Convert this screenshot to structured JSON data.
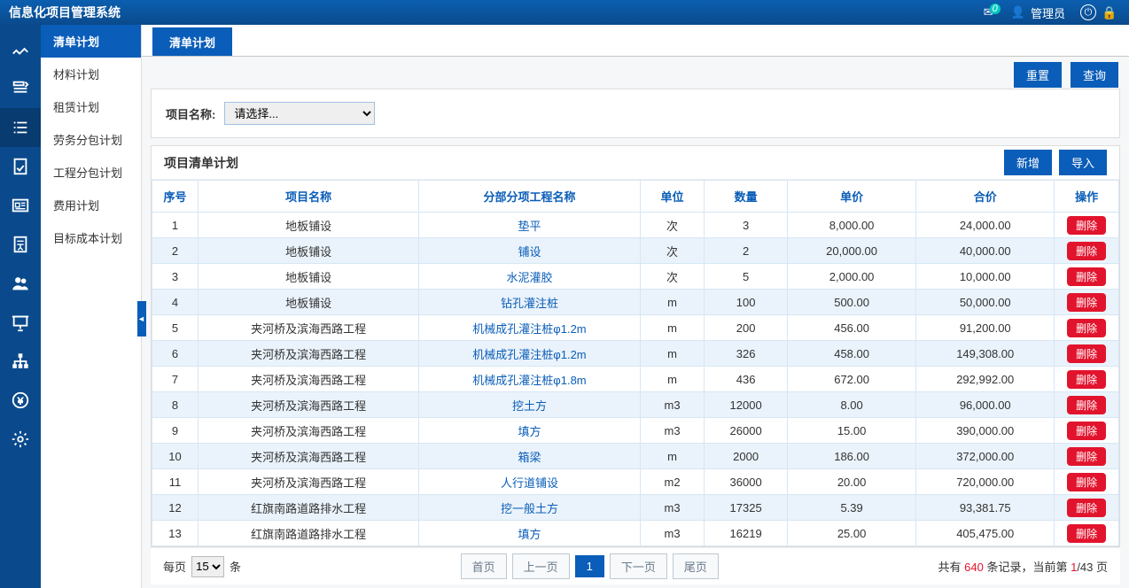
{
  "app_title": "信息化项目管理系统",
  "topbar": {
    "mail_badge": "0",
    "user_label": "管理员"
  },
  "subnav": {
    "items": [
      {
        "label": "清单计划",
        "active": true
      },
      {
        "label": "材料计划"
      },
      {
        "label": "租赁计划"
      },
      {
        "label": "劳务分包计划"
      },
      {
        "label": "工程分包计划"
      },
      {
        "label": "费用计划"
      },
      {
        "label": "目标成本计划"
      }
    ]
  },
  "tab_label": "清单计划",
  "filter": {
    "label": "项目名称:",
    "placeholder": "请选择...",
    "reset": "重置",
    "query": "查询"
  },
  "section": {
    "title": "项目清单计划",
    "add": "新增",
    "import": "导入"
  },
  "columns": [
    "序号",
    "项目名称",
    "分部分项工程名称",
    "单位",
    "数量",
    "单价",
    "合价",
    "操作"
  ],
  "delete_label": "删除",
  "rows": [
    {
      "no": "1",
      "proj": "地板铺设",
      "task": "垫平",
      "unit": "次",
      "qty": "3",
      "price": "8,000.00",
      "total": "24,000.00"
    },
    {
      "no": "2",
      "proj": "地板铺设",
      "task": "铺设",
      "unit": "次",
      "qty": "2",
      "price": "20,000.00",
      "total": "40,000.00"
    },
    {
      "no": "3",
      "proj": "地板铺设",
      "task": "水泥灌胶",
      "unit": "次",
      "qty": "5",
      "price": "2,000.00",
      "total": "10,000.00"
    },
    {
      "no": "4",
      "proj": "地板铺设",
      "task": "钻孔灌注桩",
      "unit": "m",
      "qty": "100",
      "price": "500.00",
      "total": "50,000.00"
    },
    {
      "no": "5",
      "proj": "夹河桥及滨海西路工程",
      "task": "机械成孔灌注桩φ1.2m",
      "unit": "m",
      "qty": "200",
      "price": "456.00",
      "total": "91,200.00"
    },
    {
      "no": "6",
      "proj": "夹河桥及滨海西路工程",
      "task": "机械成孔灌注桩φ1.2m",
      "unit": "m",
      "qty": "326",
      "price": "458.00",
      "total": "149,308.00"
    },
    {
      "no": "7",
      "proj": "夹河桥及滨海西路工程",
      "task": "机械成孔灌注桩φ1.8m",
      "unit": "m",
      "qty": "436",
      "price": "672.00",
      "total": "292,992.00"
    },
    {
      "no": "8",
      "proj": "夹河桥及滨海西路工程",
      "task": "挖土方",
      "unit": "m3",
      "qty": "12000",
      "price": "8.00",
      "total": "96,000.00"
    },
    {
      "no": "9",
      "proj": "夹河桥及滨海西路工程",
      "task": "填方",
      "unit": "m3",
      "qty": "26000",
      "price": "15.00",
      "total": "390,000.00"
    },
    {
      "no": "10",
      "proj": "夹河桥及滨海西路工程",
      "task": "箱梁",
      "unit": "m",
      "qty": "2000",
      "price": "186.00",
      "total": "372,000.00"
    },
    {
      "no": "11",
      "proj": "夹河桥及滨海西路工程",
      "task": "人行道铺设",
      "unit": "m2",
      "qty": "36000",
      "price": "20.00",
      "total": "720,000.00"
    },
    {
      "no": "12",
      "proj": "红旗南路道路排水工程",
      "task": "挖一般土方",
      "unit": "m3",
      "qty": "17325",
      "price": "5.39",
      "total": "93,381.75"
    },
    {
      "no": "13",
      "proj": "红旗南路道路排水工程",
      "task": "填方",
      "unit": "m3",
      "qty": "16219",
      "price": "25.00",
      "total": "405,475.00"
    }
  ],
  "pager": {
    "per_page_label_left": "每页",
    "per_page_value": "15",
    "per_page_label_right": "条",
    "first": "首页",
    "prev": "上一页",
    "current": "1",
    "next": "下一页",
    "last": "尾页",
    "summary_prefix": "共有 ",
    "summary_count": "640",
    "summary_mid": " 条记录，当前第 ",
    "summary_page": "1",
    "summary_total": "/43 页"
  }
}
